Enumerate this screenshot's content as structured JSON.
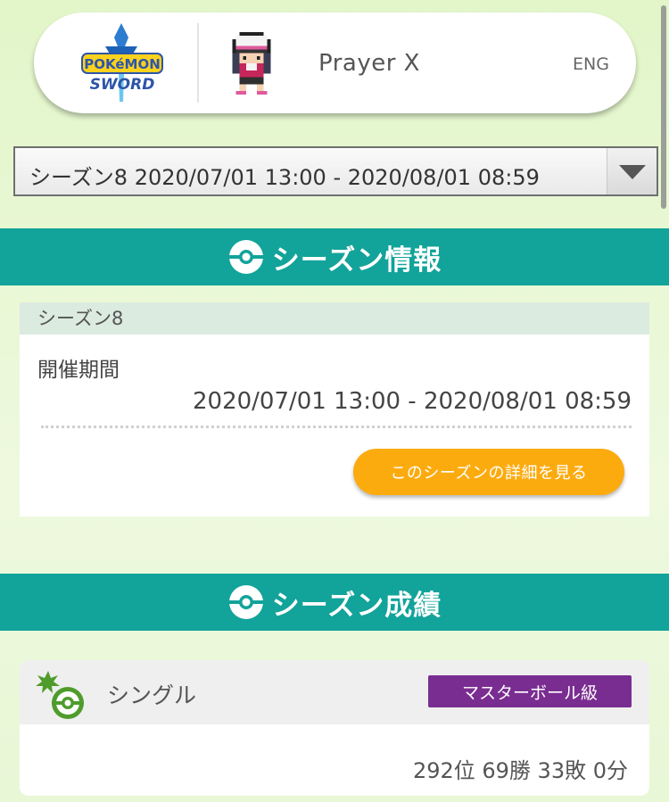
{
  "header": {
    "logo_icon": "pokemon-sword-logo-icon",
    "avatar_icon": "trainer-avatar-icon",
    "player_name": "Prayer X",
    "language": "ENG"
  },
  "season_select": {
    "selected": "シーズン8 2020/07/01 13:00 - 2020/08/01 08:59"
  },
  "season_info": {
    "title": "シーズン情報",
    "card_title": "シーズン8",
    "period_label": "開催期間",
    "period_value": "2020/07/01 13:00 - 2020/08/01 08:59",
    "detail_button": "このシーズンの詳細を見る"
  },
  "season_record": {
    "title": "シーズン成績",
    "battle_type": "シングル",
    "rank_class": "マスターボール級",
    "stats": "292位 69勝 33敗 0分"
  },
  "colors": {
    "band": "#12a39a",
    "button": "#fcab0f",
    "badge": "#7a2d91",
    "accent_green": "#4f9c2d"
  }
}
